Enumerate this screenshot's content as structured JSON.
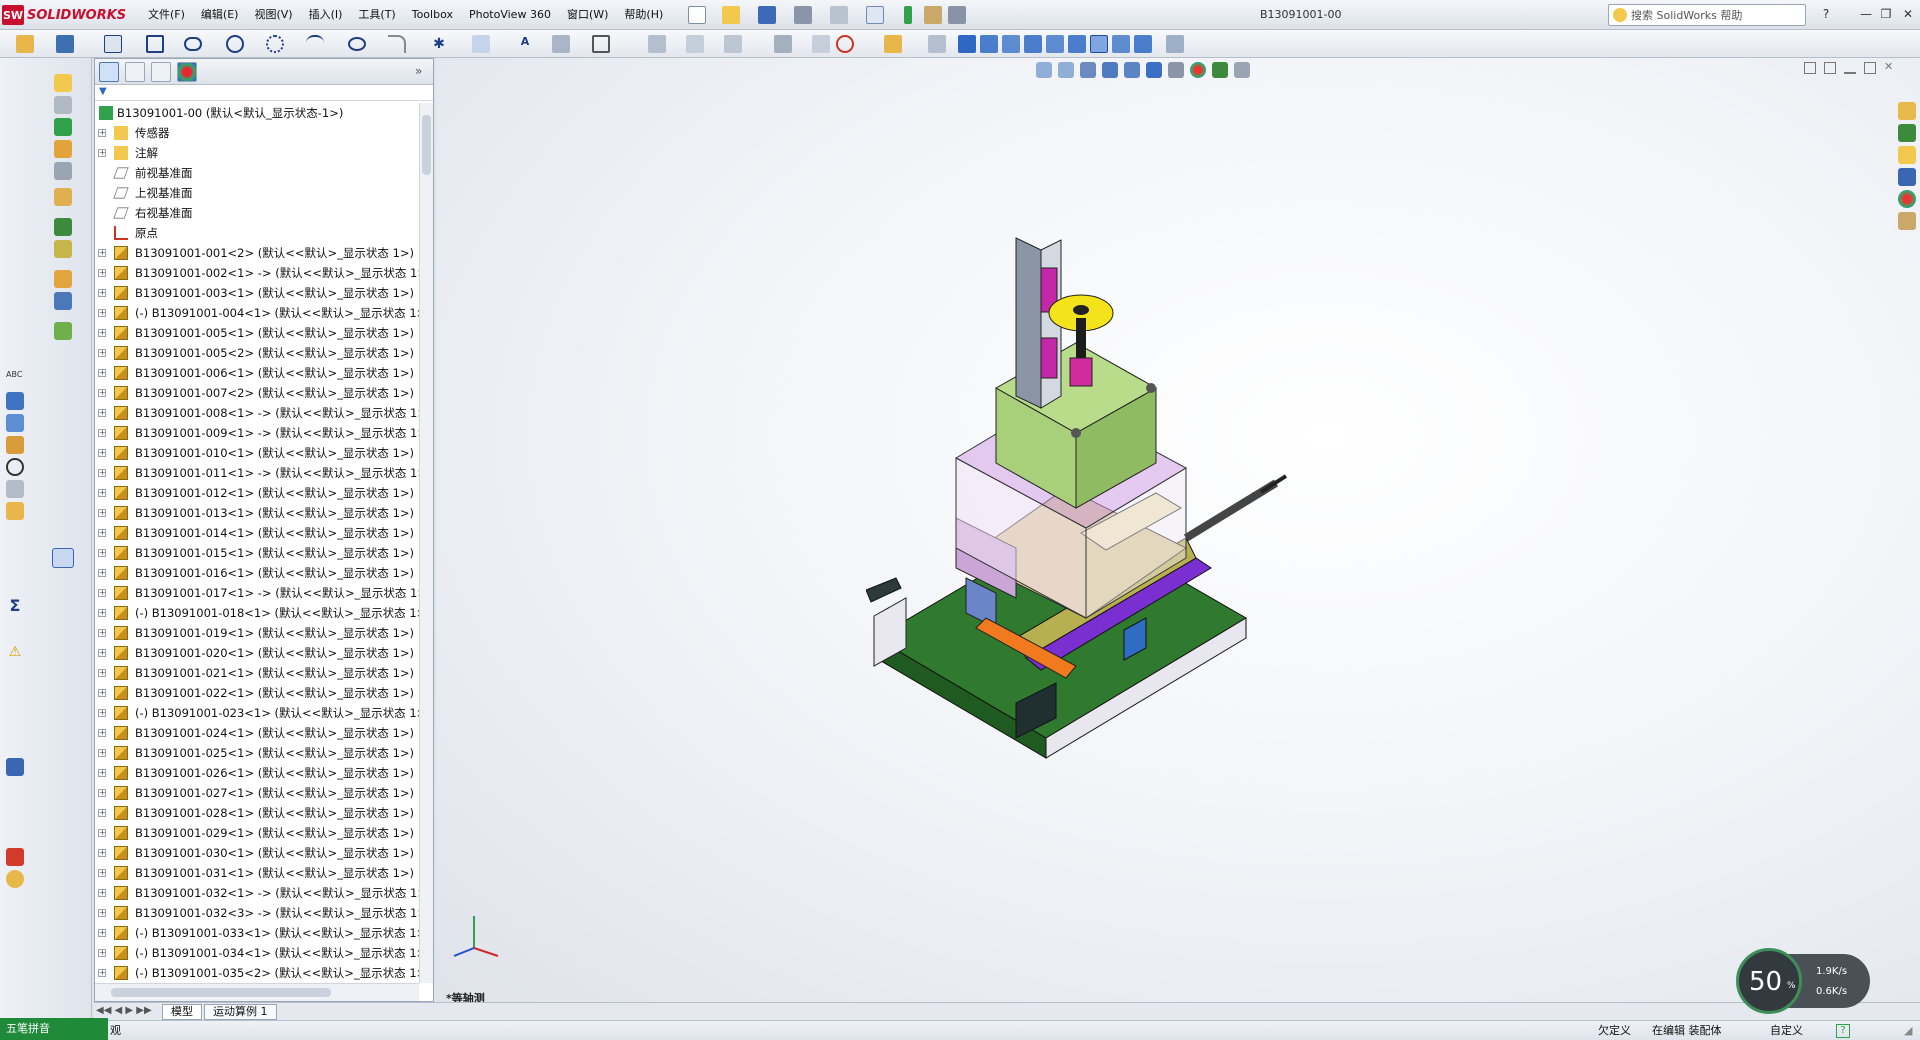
{
  "app": {
    "logo_mark": "SW",
    "logo_word": "SOLIDWORKS",
    "document_title": "B13091001-00",
    "search_placeholder": "搜索 SolidWorks 帮助"
  },
  "menu": [
    "文件(F)",
    "编辑(E)",
    "视图(V)",
    "插入(I)",
    "工具(T)",
    "Toolbox",
    "PhotoView 360",
    "窗口(W)",
    "帮助(H)"
  ],
  "window_controls": {
    "minimize": "—",
    "restore": "❐",
    "close": "✕"
  },
  "tree": {
    "root": "B13091001-00  (默认<默认_显示状态-1>)",
    "fixed_items": [
      {
        "label": "传感器",
        "icon": "sensor-icon"
      },
      {
        "label": "注解",
        "icon": "annotation-icon"
      },
      {
        "label": "前视基准面",
        "icon": "plane-icon"
      },
      {
        "label": "上视基准面",
        "icon": "plane-icon"
      },
      {
        "label": "右视基准面",
        "icon": "plane-icon"
      },
      {
        "label": "原点",
        "icon": "origin-icon"
      }
    ],
    "components": [
      "B13091001-001<2> (默认<<默认>_显示状态 1>)",
      "B13091001-002<1> -> (默认<<默认>_显示状态 1>",
      "B13091001-003<1> (默认<<默认>_显示状态 1>)",
      "(-) B13091001-004<1> (默认<<默认>_显示状态 1>",
      "B13091001-005<1> (默认<<默认>_显示状态 1>)",
      "B13091001-005<2> (默认<<默认>_显示状态 1>)",
      "B13091001-006<1> (默认<<默认>_显示状态 1>)",
      "B13091001-007<2> (默认<<默认>_显示状态 1>)",
      "B13091001-008<1> -> (默认<<默认>_显示状态 1>",
      "B13091001-009<1> -> (默认<<默认>_显示状态 1>",
      "B13091001-010<1> (默认<<默认>_显示状态 1>)",
      "B13091001-011<1> -> (默认<<默认>_显示状态 1>",
      "B13091001-012<1> (默认<<默认>_显示状态 1>)",
      "B13091001-013<1> (默认<<默认>_显示状态 1>)",
      "B13091001-014<1> (默认<<默认>_显示状态 1>)",
      "B13091001-015<1> (默认<<默认>_显示状态 1>)",
      "B13091001-016<1> (默认<<默认>_显示状态 1>)",
      "B13091001-017<1> -> (默认<<默认>_显示状态 1>",
      "(-) B13091001-018<1> (默认<<默认>_显示状态 1>",
      "B13091001-019<1> (默认<<默认>_显示状态 1>)",
      "B13091001-020<1> (默认<<默认>_显示状态 1>)",
      "B13091001-021<1> (默认<<默认>_显示状态 1>)",
      "B13091001-022<1> (默认<<默认>_显示状态 1>)",
      "(-) B13091001-023<1> (默认<<默认>_显示状态 1>",
      "B13091001-024<1> (默认<<默认>_显示状态 1>)",
      "B13091001-025<1> (默认<<默认>_显示状态 1>)",
      "B13091001-026<1> (默认<<默认>_显示状态 1>)",
      "B13091001-027<1> (默认<<默认>_显示状态 1>)",
      "B13091001-028<1> (默认<<默认>_显示状态 1>)",
      "B13091001-029<1> (默认<<默认>_显示状态 1>)",
      "B13091001-030<1> (默认<<默认>_显示状态 1>)",
      "B13091001-031<1> (默认<<默认>_显示状态 1>)",
      "B13091001-032<1> -> (默认<<默认>_显示状态 1>",
      "B13091001-032<3> -> (默认<<默认>_显示状态 1>",
      "(-) B13091001-033<1> (默认<<默认>_显示状态 1>",
      "(-) B13091001-034<1> (默认<<默认>_显示状态 1>",
      "(-) B13091001-035<2> (默认<<默认>_显示状态 1>"
    ]
  },
  "bottom_tabs": [
    "模型",
    "运动算例 1"
  ],
  "viewport": {
    "view_name": "*等轴测"
  },
  "status": {
    "ime_label": "五笔拼音",
    "left_text": "观",
    "under_defined": "欠定义",
    "editing": "在编辑 装配体",
    "custom": "自定义"
  },
  "speed_widget": {
    "percent": "50",
    "percent_unit": "%",
    "up": "1.9K/s",
    "down": "0.6K/s"
  },
  "colors": {
    "accent": "#c8102e",
    "tree_selection": "#3399ff",
    "ime_green": "#1f8b3a"
  }
}
